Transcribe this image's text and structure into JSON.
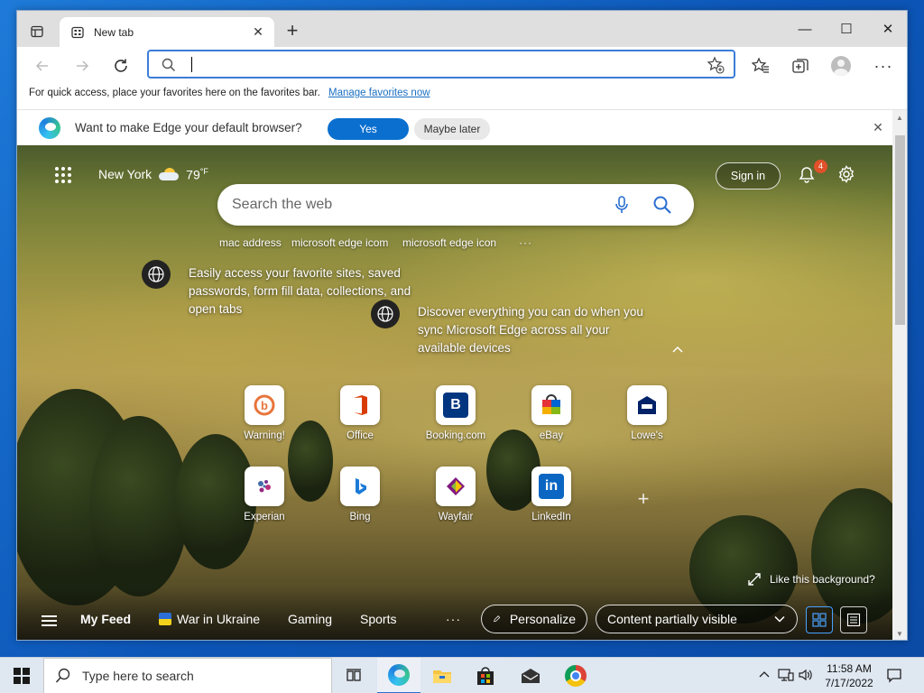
{
  "browser": {
    "tab": {
      "title": "New tab",
      "close": "✕"
    },
    "new_tab": "+",
    "window_controls": {
      "minimize": "—",
      "maximize": "☐",
      "close": "✕"
    },
    "address_placeholder": "",
    "favorites_bar": {
      "text": "For quick access, place your favorites here on the favorites bar.",
      "link": "Manage favorites now"
    }
  },
  "infobar": {
    "text": "Want to make Edge your default browser?",
    "yes": "Yes",
    "maybe": "Maybe later",
    "close": "✕"
  },
  "newtab": {
    "location": "New York",
    "temperature": "79",
    "temp_unit": "°F",
    "sign_in": "Sign in",
    "notifications": "4",
    "search_placeholder": "Search the web",
    "suggestions": [
      "mac address",
      "microsoft edge icom",
      "microsoft edge icon",
      "···"
    ],
    "tip1": "Easily access your favorite sites, saved passwords, form fill data, collections, and open tabs",
    "tip2": "Discover everything you can do when you sync Microsoft Edge across all your available devices",
    "sites": [
      {
        "label": "Warning!",
        "icon": "warning-site-icon"
      },
      {
        "label": "Office",
        "icon": "office-icon"
      },
      {
        "label": "Booking.com",
        "icon": "booking-icon"
      },
      {
        "label": "eBay",
        "icon": "ebay-icon"
      },
      {
        "label": "Lowe's",
        "icon": "lowes-icon"
      },
      {
        "label": "Experian",
        "icon": "experian-icon"
      },
      {
        "label": "Bing",
        "icon": "bing-icon"
      },
      {
        "label": "Wayfair",
        "icon": "wayfair-icon"
      },
      {
        "label": "LinkedIn",
        "icon": "linkedin-icon"
      }
    ],
    "like_background": "Like this background?",
    "feed": {
      "my_feed": "My Feed",
      "items": [
        "War in Ukraine",
        "Gaming",
        "Sports"
      ],
      "more": "···",
      "personalize": "Personalize",
      "content_visibility": "Content partially visible"
    }
  },
  "taskbar": {
    "search_placeholder": "Type here to search",
    "time": "11:58 AM",
    "date": "7/17/2022"
  },
  "colors": {
    "accent": "#0a6fcf",
    "badge": "#e0512a",
    "taskbar": "#dfe7f1"
  }
}
